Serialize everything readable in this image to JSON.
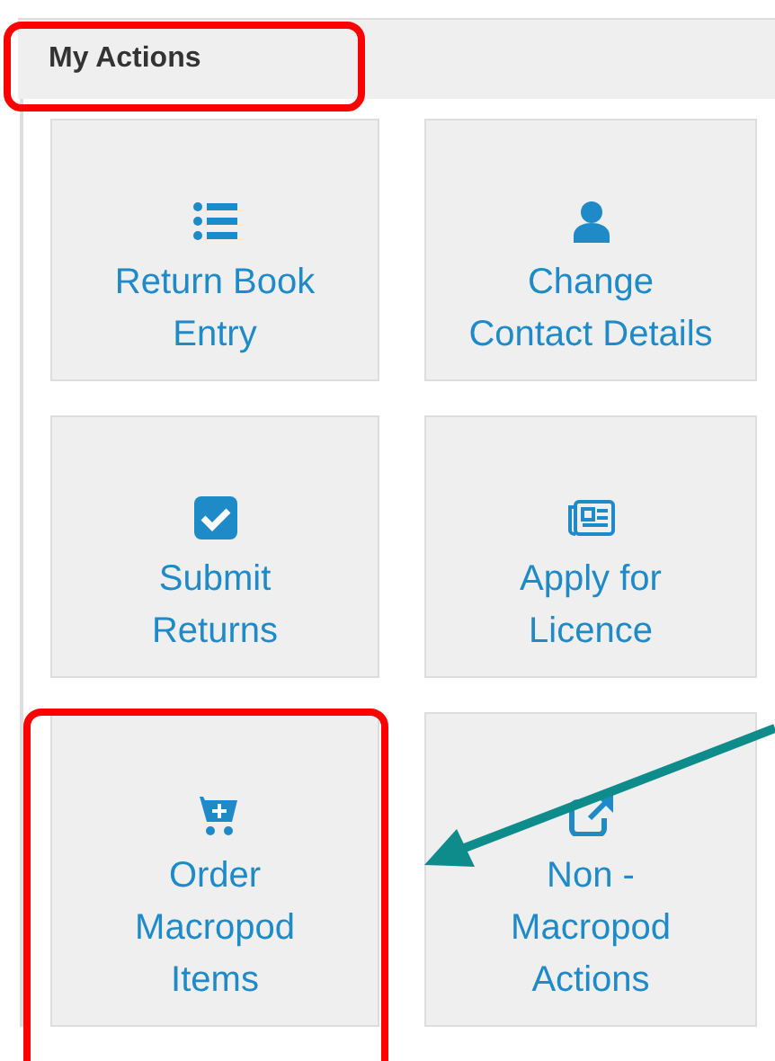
{
  "panel": {
    "title": "My Actions",
    "highlighted": true
  },
  "tiles": [
    {
      "kind": "list",
      "label_lines": [
        "Return Book",
        "Entry"
      ],
      "highlighted": false,
      "pointed_at": false
    },
    {
      "kind": "user",
      "label_lines": [
        "Change",
        "Contact Details"
      ],
      "highlighted": false,
      "pointed_at": false
    },
    {
      "kind": "checkbox",
      "label_lines": [
        "Submit",
        "Returns"
      ],
      "highlighted": false,
      "pointed_at": false
    },
    {
      "kind": "newspaper",
      "label_lines": [
        "Apply for",
        "Licence"
      ],
      "highlighted": false,
      "pointed_at": false
    },
    {
      "kind": "cart",
      "label_lines": [
        "Order",
        "Macropod",
        "Items"
      ],
      "highlighted": true,
      "pointed_at": true
    },
    {
      "kind": "external",
      "label_lines": [
        "Non -",
        "Macropod",
        "Actions"
      ],
      "highlighted": false,
      "pointed_at": false
    }
  ]
}
